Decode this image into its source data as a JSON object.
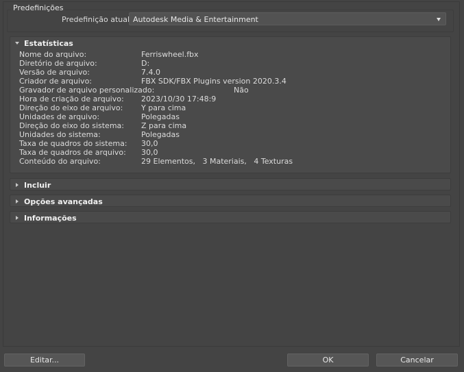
{
  "presets": {
    "group_title": "Predefinições",
    "current_label": "Predefinição atual:",
    "current_value": "Autodesk Media & Entertainment"
  },
  "statistics": {
    "title": "Estatísticas",
    "rows": [
      {
        "label": "Nome do arquivo:",
        "value": "Ferriswheel.fbx"
      },
      {
        "label": "Diretório de arquivo:",
        "value": "D:"
      },
      {
        "label": "Versão de arquivo:",
        "value": "7.4.0"
      },
      {
        "label": "Criador de arquivo:",
        "value": "FBX SDK/FBX Plugins version 2020.3.4"
      },
      {
        "label": "Gravador de arquivo personalizado:",
        "value": "Não"
      },
      {
        "label": "Hora de criação de arquivo:",
        "value": "2023/10/30  17:48:9"
      },
      {
        "label": "Direção do eixo de arquivo:",
        "value": "Y para cima"
      },
      {
        "label": "Unidades de arquivo:",
        "value": "Polegadas"
      },
      {
        "label": "Direção do eixo do sistema:",
        "value": "Z para cima"
      },
      {
        "label": "Unidades do sistema:",
        "value": "Polegadas"
      },
      {
        "label": "Taxa de quadros do sistema:",
        "value": "30,0"
      },
      {
        "label": "Taxa de quadros de arquivo:",
        "value": "30,0"
      },
      {
        "label": "Conteúdo do arquivo:",
        "value": "29 Elementos,   3 Materiais,   4 Texturas"
      }
    ]
  },
  "rollouts": {
    "include": "Incluir",
    "advanced": "Opções avançadas",
    "info": "Informações"
  },
  "buttons": {
    "edit": "Editar...",
    "ok": "OK",
    "cancel": "Cancelar"
  }
}
